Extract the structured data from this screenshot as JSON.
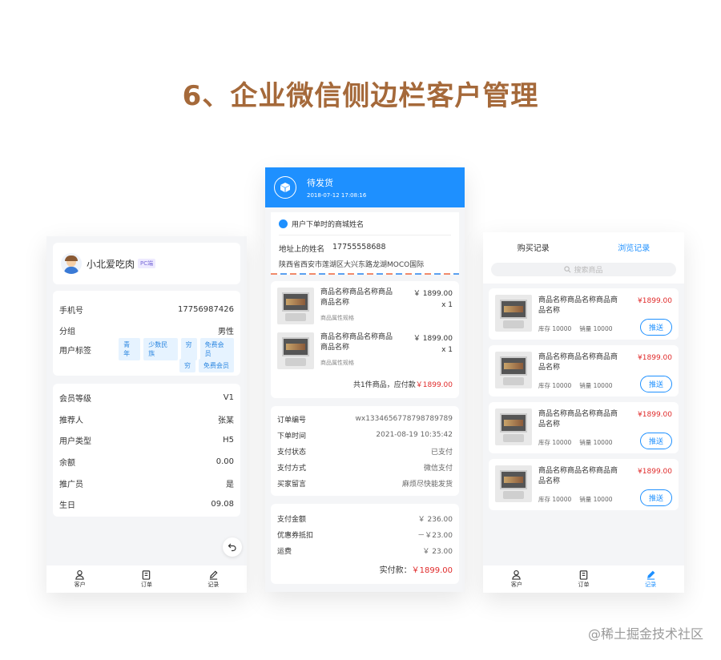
{
  "page_title": "6、企业微信侧边栏客户管理",
  "watermark": "@稀土掘金技术社区",
  "left": {
    "user_name": "小北爱吃肉",
    "pc_tag": "PC端",
    "info": [
      {
        "label": "手机号",
        "value": "17756987426"
      },
      {
        "label": "分组",
        "value": "男性"
      }
    ],
    "tags_label": "用户标签",
    "tags_row1": [
      "青年",
      "少数民族",
      "穷",
      "免费会员"
    ],
    "tags_row2": [
      "穷",
      "免费会员"
    ],
    "member": [
      {
        "label": "会员等级",
        "value": "V1"
      },
      {
        "label": "推荐人",
        "value": "张某"
      },
      {
        "label": "用户类型",
        "value": "H5"
      },
      {
        "label": "余额",
        "value": "0.00"
      },
      {
        "label": "推广员",
        "value": "是"
      },
      {
        "label": "生日",
        "value": "09.08"
      }
    ],
    "nav": [
      "客户",
      "订单",
      "记录"
    ]
  },
  "middle": {
    "status": "待发货",
    "status_time": "2018-07-12  17:08:16",
    "shop_name": "用户下单时的商城姓名",
    "address_name": "地址上的姓名",
    "address_phone": "17755558688",
    "address": "陕西省西安市莲湖区大兴东路龙湖MOCO国际",
    "items": [
      {
        "name": "商品名称商品名称商品商品名称",
        "price": "￥ 1899.00",
        "qty": "x 1",
        "spec": "商品属性规格"
      },
      {
        "name": "商品名称商品名称商品商品名称",
        "price": "￥ 1899.00",
        "qty": "x 1",
        "spec": "商品属性规格"
      }
    ],
    "total_prefix": "共1件商品，应付款",
    "total_amount": "￥1899.00",
    "order_info": [
      {
        "label": "订单编号",
        "value": "wx1334656778798789789"
      },
      {
        "label": "下单时间",
        "value": "2021-08-19 10:35:42"
      },
      {
        "label": "支付状态",
        "value": "已支付"
      },
      {
        "label": "支付方式",
        "value": "微信支付"
      },
      {
        "label": "买家留言",
        "value": "麻烦尽快能发货"
      }
    ],
    "payment": [
      {
        "label": "支付金额",
        "value": "￥ 236.00"
      },
      {
        "label": "优惠券抵扣",
        "value": "－￥23.00"
      },
      {
        "label": "运费",
        "value": "￥ 23.00"
      }
    ],
    "paid_label": "实付款：",
    "paid_value": "￥1899.00"
  },
  "right": {
    "tab_purchase": "购买记录",
    "tab_browse": "浏览记录",
    "search_placeholder": "搜索商品",
    "products": [
      {
        "name": "商品名称商品名称商品商品名称",
        "price": "¥1899.00",
        "stock": "库存 10000",
        "sales": "销量 10000",
        "btn": "推送"
      },
      {
        "name": "商品名称商品名称商品商品名称",
        "price": "¥1899.00",
        "stock": "库存 10000",
        "sales": "销量 10000",
        "btn": "推送"
      },
      {
        "name": "商品名称商品名称商品商品名称",
        "price": "¥1899.00",
        "stock": "库存 10000",
        "sales": "销量 10000",
        "btn": "推送"
      },
      {
        "name": "商品名称商品名称商品商品名称",
        "price": "¥1899.00",
        "stock": "库存 10000",
        "sales": "销量 10000",
        "btn": "推送"
      }
    ],
    "nav": [
      "客户",
      "订单",
      "记录"
    ]
  },
  "colors": {
    "accent": "#1e90ff",
    "title": "#a5693a",
    "price": "#e02b2b"
  }
}
